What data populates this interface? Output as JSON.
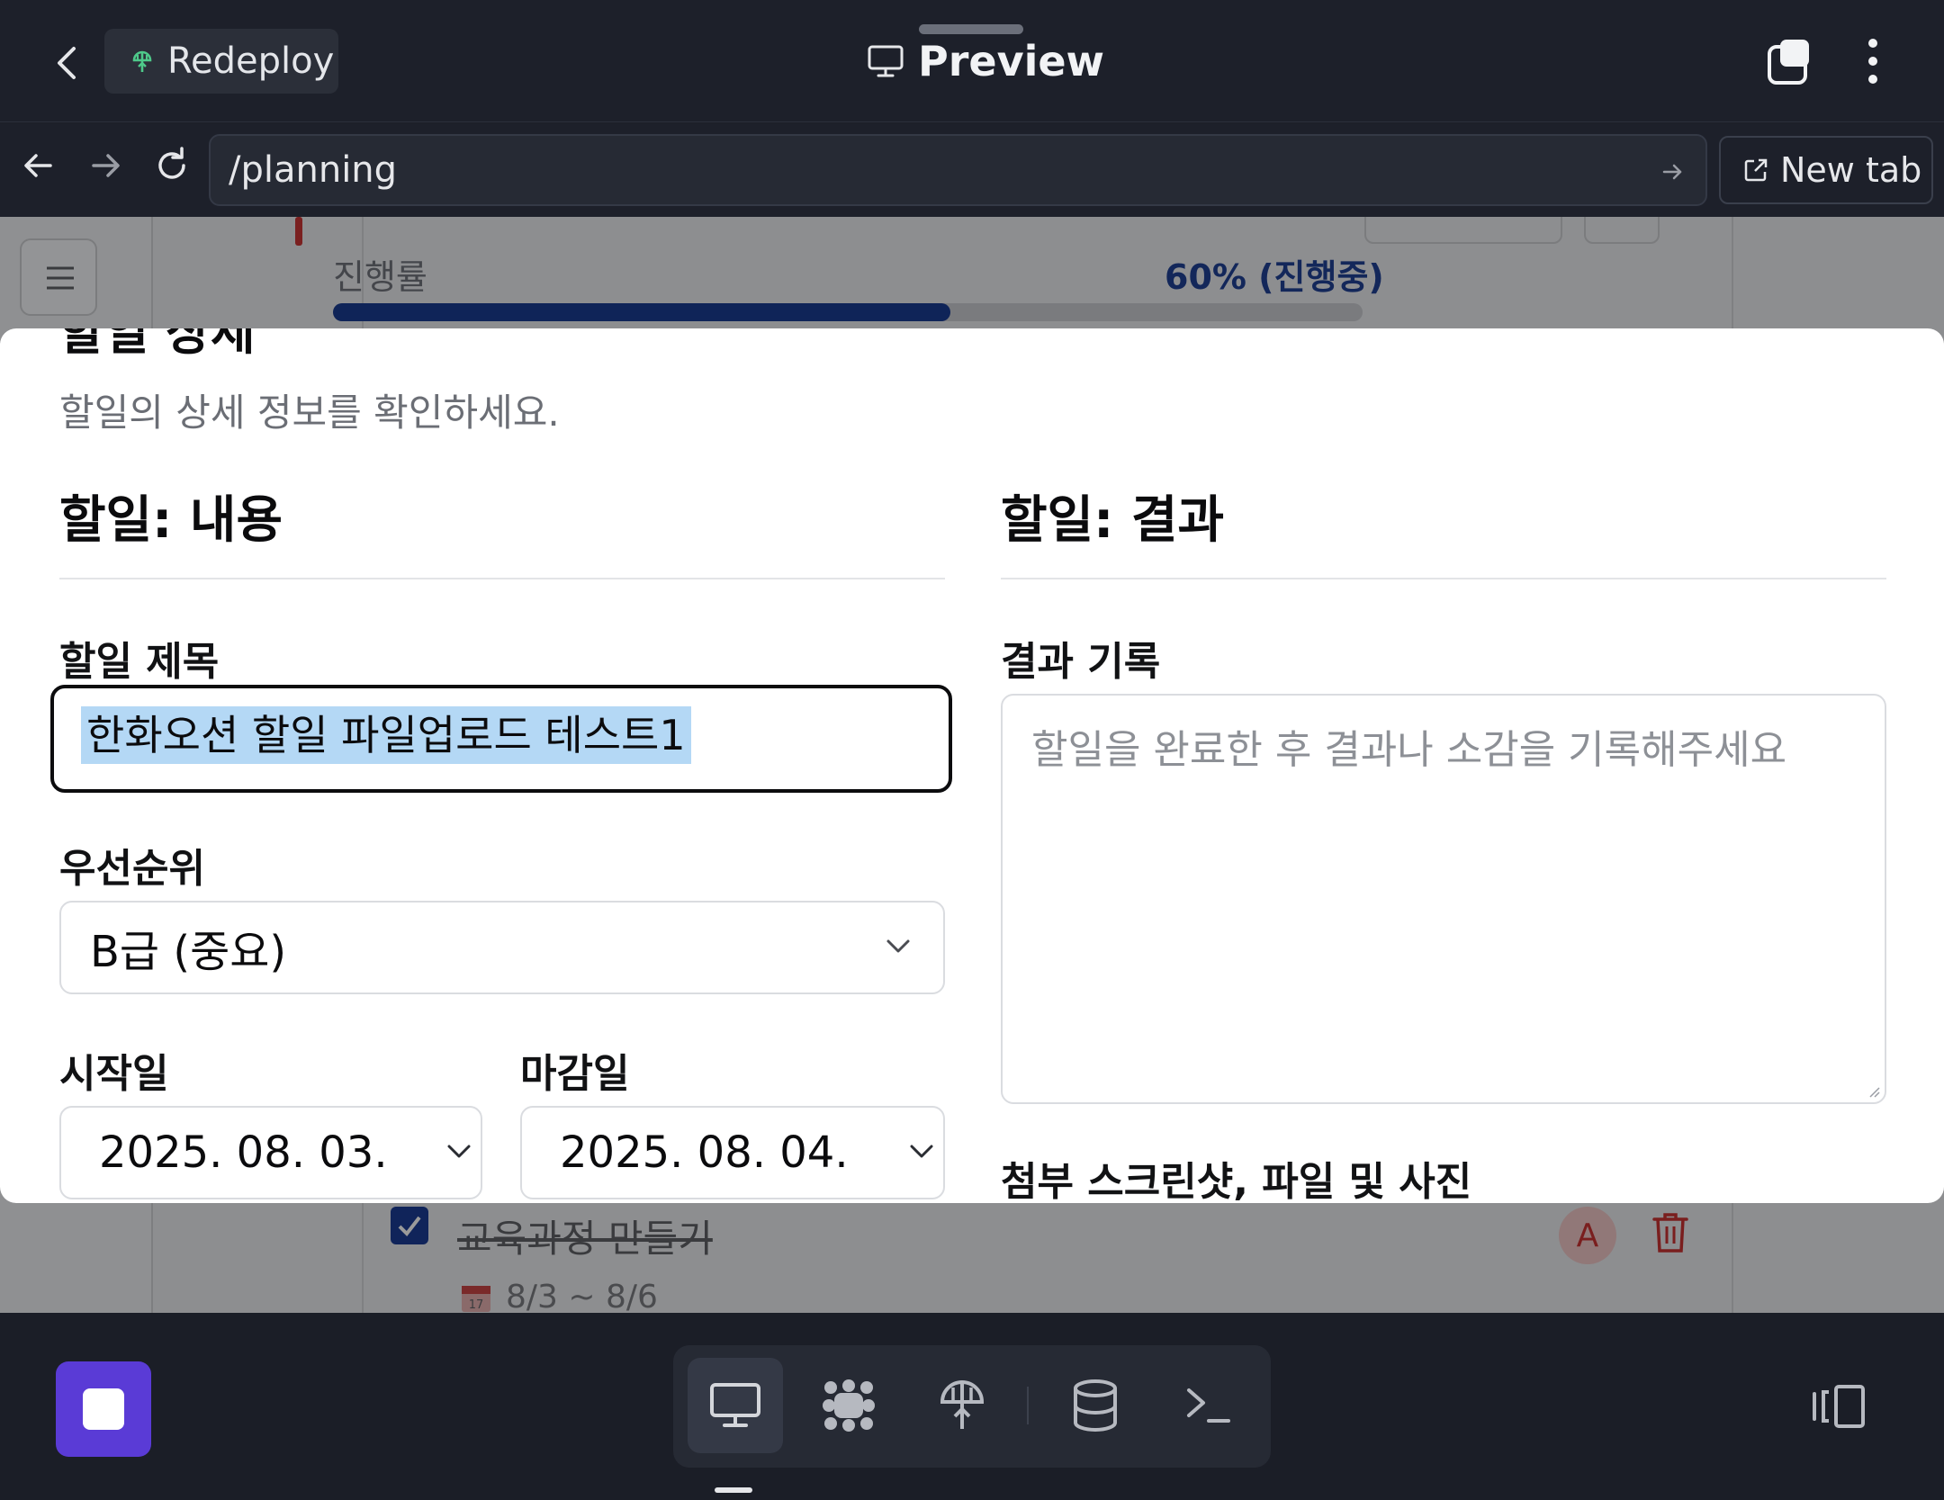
{
  "header": {
    "redeploy_label": "Redeploy",
    "title": "Preview"
  },
  "navbar": {
    "url": "/planning",
    "new_tab_label": "New tab"
  },
  "background_app": {
    "progress_label": "진행률",
    "progress_value": "60% (진행중)",
    "progress_fraction": 0.6,
    "task_title": "교육과정 만들기",
    "task_date": "8/3 ~ 8/6",
    "assignee_initial": "A"
  },
  "modal": {
    "title": "할일 상세",
    "description": "할일의 상세 정보를 확인하세요.",
    "left_section_title": "할일: 내용",
    "right_section_title": "할일: 결과",
    "task_title_label": "할일 제목",
    "task_title_value": "한화오션 할일 파일업로드 테스트1",
    "priority_label": "우선순위",
    "priority_value": "B급 (중요)",
    "start_date_label": "시작일",
    "start_date_value": "2025. 08. 03.",
    "due_date_label": "마감일",
    "due_date_value": "2025. 08. 04.",
    "result_label": "결과 기록",
    "result_placeholder": "할일을 완료한 후 결과나 소감을 기록해주세요",
    "attachments_label": "첨부 스크린샷, 파일 및 사진"
  },
  "dock": {
    "items": [
      "monitor-icon",
      "apps-icon",
      "deploy-icon",
      "database-icon",
      "terminal-icon"
    ],
    "active": "monitor-icon"
  },
  "colors": {
    "accent_purple": "#5a3bd6",
    "progress_navy": "#0f2458",
    "selection_blue": "#b4d8f5"
  }
}
